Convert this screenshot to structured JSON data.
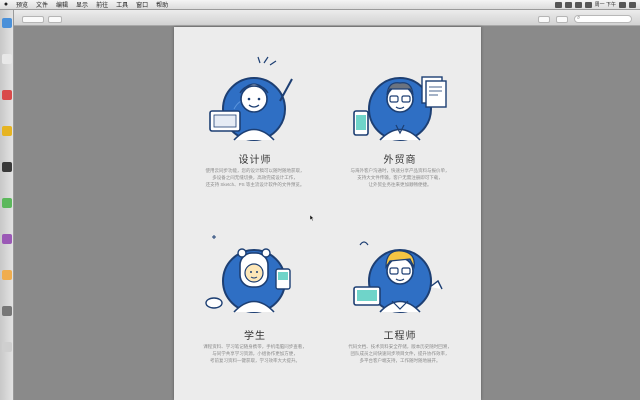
{
  "menubar": {
    "items": [
      "预览",
      "文件",
      "编辑",
      "显示",
      "前往",
      "工具",
      "窗口",
      "帮助"
    ],
    "clock": "周一 下午"
  },
  "window": {
    "title": "",
    "search_placeholder": ""
  },
  "roles": [
    {
      "title": "设计师",
      "desc": [
        "使用云同步功能，您的设计稿可以随时随地获取，",
        "多设备之间无缝切换，高效完成设计工作，",
        "还支持 Sketch、PS 等主流设计软件的文件预览。"
      ]
    },
    {
      "title": "外贸商",
      "desc": [
        "与海外客户沟通时，快速分享产品资料与报价单，",
        "支持大文件传输，客户无需注册即可下载，",
        "让外贸业务往来更加顺畅便捷。"
      ]
    },
    {
      "title": "学生",
      "desc": [
        "课程资料、学习笔记随身携带，手机电脑同步查看，",
        "与同学共享学习资源，小组协作更加方便，",
        "考前复习资料一键获取，学习效率大大提升。"
      ]
    },
    {
      "title": "工程师",
      "desc": [
        "代码文档、技术资料安全存储，版本历史随时回溯，",
        "团队成员之间快速同步项目文件，提升协作效率，",
        "多平台客户端支持，工作随时随地展开。"
      ]
    }
  ],
  "colors": {
    "accent": "#3a7fd0",
    "circle_bg": "#2f6fc4",
    "outline": "#1d3f73",
    "hair_yellow": "#f5c542",
    "paper": "#ececec",
    "desktop": "#8a8a8a"
  },
  "dock_icons": [
    "finder-icon",
    "safari-icon",
    "mail-icon",
    "chrome-icon",
    "calendar-icon",
    "terminal-icon",
    "photos-icon",
    "notes-icon",
    "settings-icon",
    "trash-icon"
  ]
}
